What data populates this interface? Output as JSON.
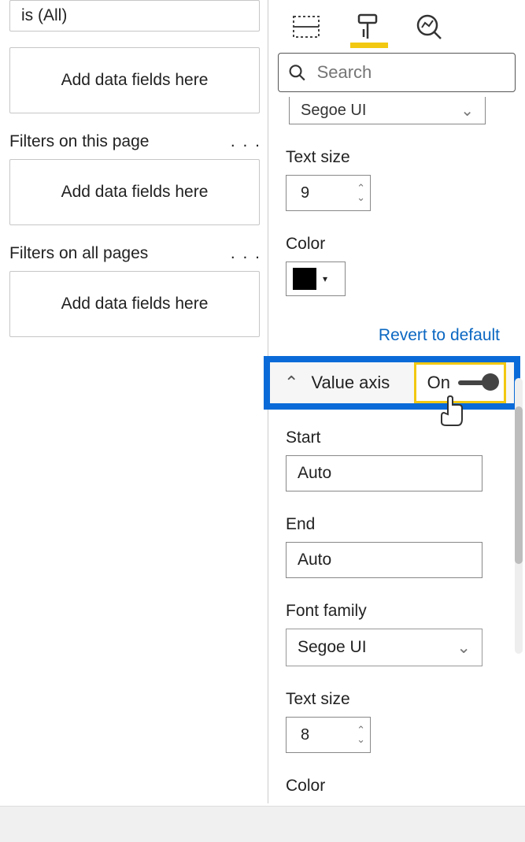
{
  "filters": {
    "first_card_text": "is (All)",
    "add_fields_label": "Add data fields here",
    "page_filters_heading": "Filters on this page",
    "all_pages_heading": "Filters on all pages"
  },
  "search": {
    "placeholder": "Search"
  },
  "xaxis": {
    "font_family_value": "Segoe UI",
    "text_size_label": "Text size",
    "text_size_value": "9",
    "color_label": "Color",
    "color_value": "#000000",
    "revert_label": "Revert to default"
  },
  "value_axis": {
    "title": "Value axis",
    "toggle_state": "On",
    "start_label": "Start",
    "start_value": "Auto",
    "end_label": "End",
    "end_value": "Auto",
    "font_family_label": "Font family",
    "font_family_value": "Segoe UI",
    "text_size_label": "Text size",
    "text_size_value": "8",
    "color_label": "Color"
  }
}
